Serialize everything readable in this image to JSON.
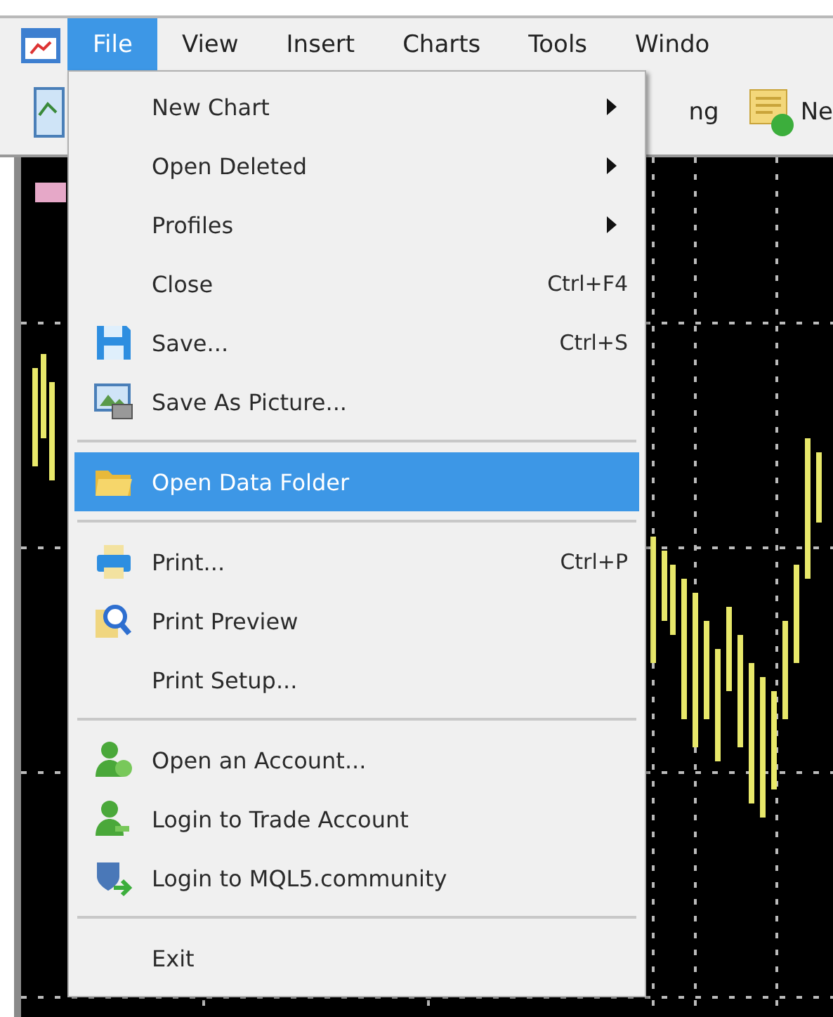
{
  "menu_bar": [
    {
      "label": "File",
      "selected": true
    },
    {
      "label": "View",
      "selected": false
    },
    {
      "label": "Insert",
      "selected": false
    },
    {
      "label": "Charts",
      "selected": false
    },
    {
      "label": "Tools",
      "selected": false
    },
    {
      "label": "Windo",
      "selected": false
    }
  ],
  "toolbar": {
    "label_1": "ng",
    "label_2": "Ne"
  },
  "file_menu": [
    {
      "kind": "item",
      "label": "New Chart",
      "submenu": true,
      "selected": false
    },
    {
      "kind": "item",
      "label": "Open Deleted",
      "submenu": true,
      "selected": false
    },
    {
      "kind": "item",
      "label": "Profiles",
      "submenu": true,
      "selected": false
    },
    {
      "kind": "item",
      "label": "Close",
      "shortcut": "Ctrl+F4",
      "selected": false
    },
    {
      "kind": "item",
      "label": "Save...",
      "shortcut": "Ctrl+S",
      "selected": false
    },
    {
      "kind": "item",
      "label": "Save As Picture...",
      "selected": false
    },
    {
      "kind": "separator"
    },
    {
      "kind": "item",
      "label": "Open Data Folder",
      "selected": true
    },
    {
      "kind": "separator"
    },
    {
      "kind": "item",
      "label": "Print...",
      "shortcut": "Ctrl+P",
      "selected": false
    },
    {
      "kind": "item",
      "label": "Print Preview",
      "selected": false
    },
    {
      "kind": "item",
      "label": "Print Setup...",
      "selected": false
    },
    {
      "kind": "separator"
    },
    {
      "kind": "item",
      "label": "Open an Account...",
      "selected": false
    },
    {
      "kind": "item",
      "label": "Login to Trade Account",
      "selected": false
    },
    {
      "kind": "item",
      "label": "Login to MQL5.community",
      "selected": false
    },
    {
      "kind": "separator"
    },
    {
      "kind": "item",
      "label": "Exit",
      "selected": false
    }
  ]
}
